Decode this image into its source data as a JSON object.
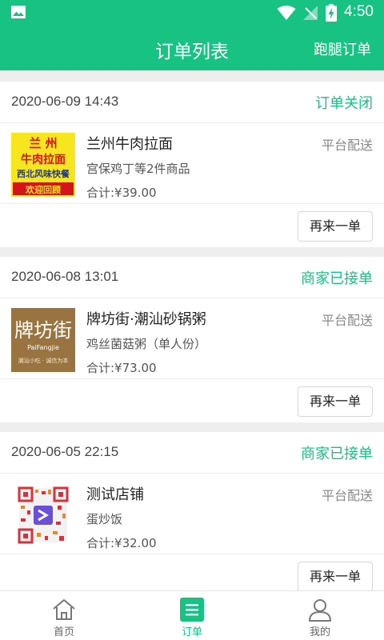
{
  "status_bar": {
    "time": "4:50"
  },
  "header": {
    "title": "订单列表",
    "right_action": "跑腿订单"
  },
  "orders": [
    {
      "time": "2020-06-09 14:43",
      "status": "订单关闭",
      "shop": "兰州牛肉拉面",
      "delivery": "平台配送",
      "items": "宫保鸡丁等2件商品",
      "total": "合计:¥39.00",
      "reorder_label": "再来一单",
      "logo_text": [
        "兰 州",
        "牛肉拉面",
        "西北风味快餐",
        "欢迎回顾"
      ]
    },
    {
      "time": "2020-06-08 13:01",
      "status": "商家已接单",
      "shop": "牌坊街·潮汕砂锅粥",
      "delivery": "平台配送",
      "items": "鸡丝菌菇粥（单人份）",
      "total": "合计:¥73.00",
      "reorder_label": "再来一单",
      "logo_text": [
        "牌坊街",
        "PaiFangjie",
        "潮汕小吃 · 诚信为本"
      ]
    },
    {
      "time": "2020-06-05 22:15",
      "status": "商家已接单",
      "shop": "测试店铺",
      "delivery": "平台配送",
      "items": "蛋炒饭",
      "total": "合计:¥32.00",
      "reorder_label": "再来一单"
    }
  ],
  "tabs": [
    {
      "label": "首页",
      "icon": "home-icon",
      "active": false
    },
    {
      "label": "订单",
      "icon": "orders-icon",
      "active": true
    },
    {
      "label": "我的",
      "icon": "profile-icon",
      "active": false
    }
  ],
  "colors": {
    "accent": "#18c283",
    "background": "#eeeeee"
  }
}
